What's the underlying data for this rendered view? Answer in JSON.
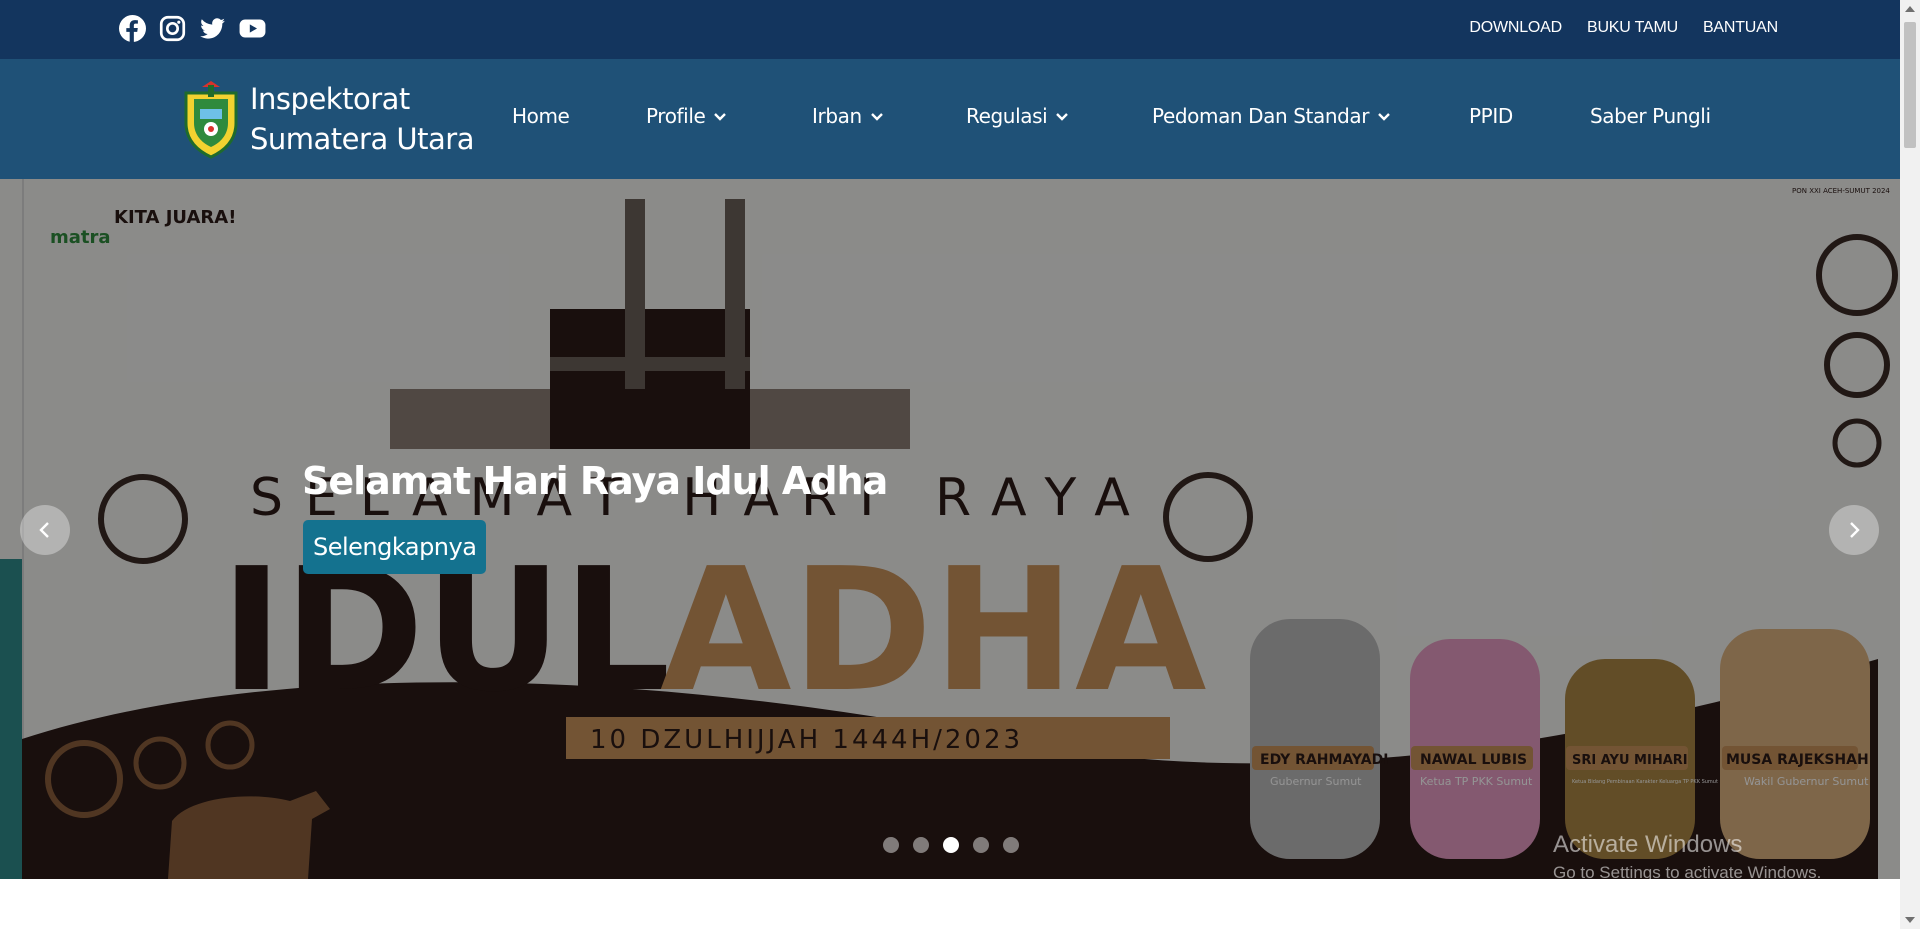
{
  "socials": [
    {
      "icon": "facebook-icon"
    },
    {
      "icon": "instagram-icon"
    },
    {
      "icon": "twitter-icon"
    },
    {
      "icon": "youtube-icon"
    }
  ],
  "top_links": [
    "DOWNLOAD",
    "BUKU TAMU",
    "BANTUAN"
  ],
  "brand": {
    "line1": "Inspektorat",
    "line2": "Sumatera Utara"
  },
  "nav": [
    {
      "label": "Home",
      "dropdown": false
    },
    {
      "label": "Profile",
      "dropdown": true
    },
    {
      "label": "Irban",
      "dropdown": true
    },
    {
      "label": "Regulasi",
      "dropdown": true
    },
    {
      "label": "Pedoman Dan Standar",
      "dropdown": true
    },
    {
      "label": "PPID",
      "dropdown": false
    },
    {
      "label": "Saber Pungli",
      "dropdown": false
    }
  ],
  "hero": {
    "caption_title": "Selamat Hari Raya Idul Adha",
    "cta_label": "Selengkapnya",
    "banner": {
      "arc_text": "SELAMAT HARI RAYA",
      "word_left": "IDUL",
      "word_right": "ADHA",
      "date": "10 DZULHIJJAH 1444H/2023",
      "logo_word": "matra",
      "logo_badge": "KITA JUARA!",
      "event_badge": "PON XXI ACEH-SUMUT 2024",
      "people": [
        {
          "name": "EDY RAHMAYADI",
          "role": "Gubernur Sumut"
        },
        {
          "name": "NAWAL LUBIS",
          "role": "Ketua TP PKK Sumut"
        },
        {
          "name": "SRI AYU MIHARI",
          "role": "Ketua Bidang Pembinaan Karakter Keluarga TP PKK Sumut"
        },
        {
          "name": "MUSA RAJEKSHAH",
          "role": "Wakil Gubernur Sumut"
        }
      ]
    },
    "slide_count": 5,
    "active_slide": 3
  },
  "watermark": {
    "title": "Activate Windows",
    "subtitle": "Go to Settings to activate Windows."
  },
  "colors": {
    "topbar": "#13355e",
    "navbar": "#1f5177",
    "cta": "#14728f",
    "banner_brown": "#2b1a17",
    "banner_tan": "#c7915b"
  }
}
